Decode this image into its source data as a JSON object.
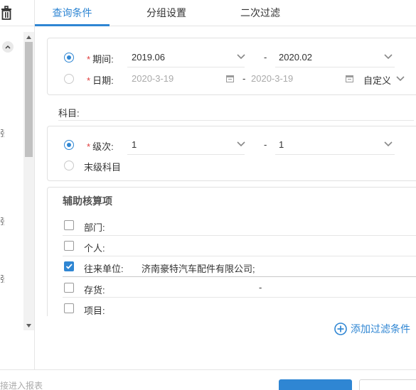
{
  "tabs": [
    {
      "label": "查询条件",
      "active": true
    },
    {
      "label": "分组设置",
      "active": false
    },
    {
      "label": "二次过滤",
      "active": false
    }
  ],
  "period": {
    "required_mark": "*",
    "period_label": "期间:",
    "period_from": "2019.06",
    "period_to": "2020.02",
    "date_label": "日期:",
    "date_from": "2020-3-19",
    "date_to": "2020-3-19",
    "custom_label": "自定义",
    "separator": "-"
  },
  "subject": {
    "label": "科目:"
  },
  "level": {
    "required_mark": "*",
    "level_label": "级次:",
    "level_from": "1",
    "level_to": "1",
    "separator": "-",
    "leaf_label": "末级科目"
  },
  "auxiliary": {
    "title": "辅助核算项",
    "items": [
      {
        "label": "部门:",
        "value": "",
        "checked": false
      },
      {
        "label": "个人:",
        "value": "",
        "checked": false
      },
      {
        "label": "往来单位:",
        "value": "济南豪特汽车配件有限公司;",
        "checked": true
      },
      {
        "label": "存货:",
        "value": "-",
        "checked": false
      },
      {
        "label": "项目:",
        "value": "",
        "checked": false
      }
    ]
  },
  "add_filter_label": "添加过滤条件",
  "footer": {
    "hint": "接进入报表"
  },
  "left_panel": {
    "marks": [
      "张",
      "张",
      "张"
    ]
  },
  "colors": {
    "accent": "#2f86d3",
    "required": "#e03b3b"
  }
}
